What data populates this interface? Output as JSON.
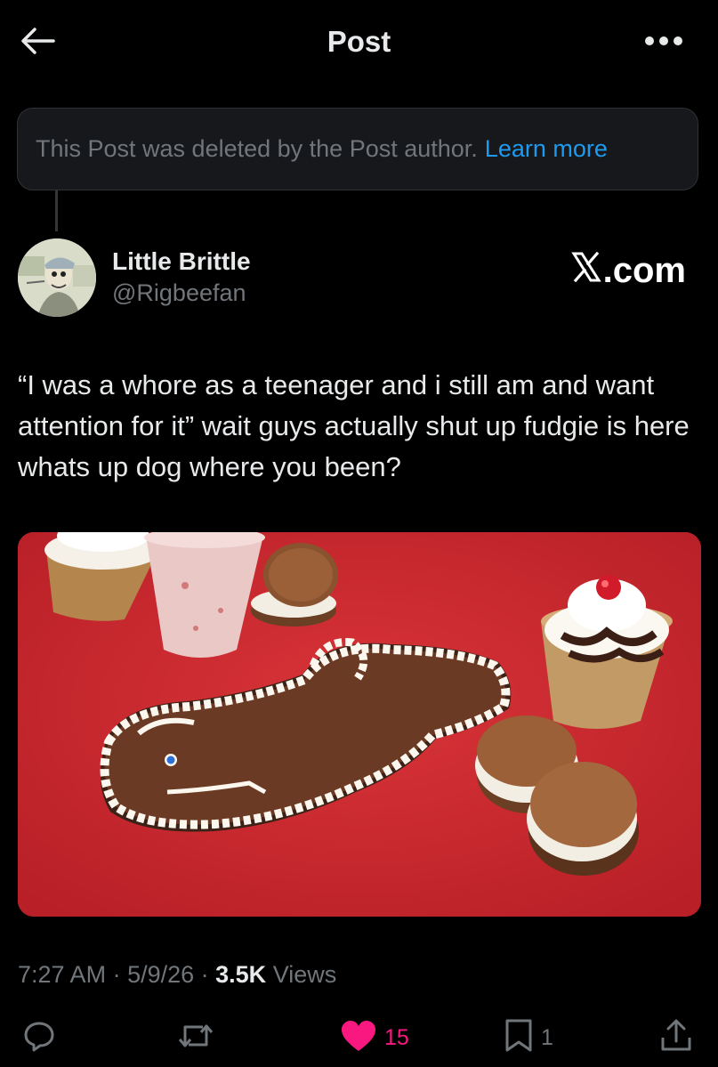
{
  "header": {
    "title": "Post"
  },
  "notice": {
    "text": "This Post was deleted by the Post author.",
    "link": "Learn more"
  },
  "author": {
    "name": "Little Brittle",
    "handle": "@Rigbeefan"
  },
  "brand": {
    "label": ".com"
  },
  "post": {
    "text": "“I was a whore as a teenager and i still am and want attention for it” wait guys actually shut up fudgie is here whats up dog where you been?"
  },
  "meta": {
    "time": "7:27 AM",
    "sep1": " · ",
    "date": "5/9/26",
    "sep2": " · ",
    "views_count": "3.5K",
    "views_label": " Views"
  },
  "actions": {
    "likes": "15",
    "bookmarks": "1"
  },
  "colors": {
    "background": "#000000",
    "text": "#e7e9ea",
    "secondary": "#71767b",
    "link": "#1d9bf0",
    "like": "#f91880"
  }
}
